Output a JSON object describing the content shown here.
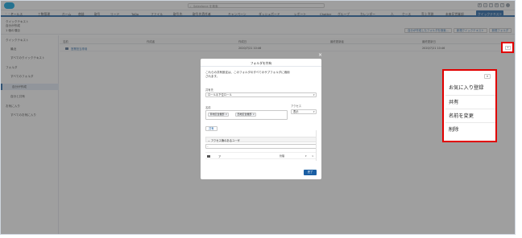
{
  "header": {
    "search_placeholder": "Salesforce を検索",
    "search_scope": "すべて"
  },
  "nav": {
    "items": [
      "セールス",
      "工数管理",
      "ホーム",
      "商談",
      "取引",
      "リード",
      "ToDo",
      "ファイル",
      "取引先",
      "取引先責任者",
      "キャンペーン",
      "ダッシュボード",
      "レポート",
      "Chatter",
      "グループ",
      "カレンダー",
      "人",
      "ケース",
      "売上予測",
      "未来区営業部",
      "クイックテキスト"
    ]
  },
  "titlebar": {
    "line1": "クイックテキスト",
    "line2": "自分が作成",
    "line3": "1 個の項目",
    "buttons": [
      "自分が作成したフォルダを検索...",
      "新規クイックテキスト",
      "新規フォルダ"
    ]
  },
  "sidebar": {
    "items": [
      {
        "label": "クイックテキスト",
        "child": false
      },
      {
        "label": "最近",
        "child": true
      },
      {
        "label": "すべてのクイックテキスト",
        "child": true
      },
      {
        "label": "フォルダ",
        "child": false
      },
      {
        "label": "すべてのフォルダ",
        "child": true
      },
      {
        "label": "自分が作成",
        "child": true,
        "selected": true
      },
      {
        "label": "自分と共有",
        "child": true
      },
      {
        "label": "お気に入り",
        "child": false
      },
      {
        "label": "すべてのお気に入り",
        "child": true
      }
    ]
  },
  "table": {
    "columns": [
      "名前",
      "作成者",
      "作成日",
      "最終更新者",
      "最終更新日"
    ],
    "rows": [
      {
        "name": "営業担当専用",
        "created_by": "",
        "created_date": "2020/7/21 10:46",
        "modified_by": "",
        "modified_date": "2020/7/21 10:46"
      }
    ]
  },
  "modal": {
    "title": "フォルダを共有",
    "description_line1": "これらの共有設定は、このフォルダのすべてのサブフォルダに適用",
    "description_line2": "されます。",
    "share_with_label": "共有先",
    "share_with_value": "ロール＆下位ロール",
    "name_label": "名前",
    "access_label": "アクセス",
    "access_value": "表示",
    "pills": [
      "東地区営業部",
      "西地区営業部"
    ],
    "share_button": "共有",
    "section_title": "アクセス権のあるユーザ",
    "user_row": {
      "name": "ア",
      "access": "管理"
    },
    "done_button": "完了"
  },
  "dropdown": {
    "items": [
      "お気に入り登録",
      "共有",
      "名前を変更",
      "削除"
    ]
  },
  "colors": {
    "brand": "#1b5fa4",
    "highlight": "#e10000",
    "logo": "#00a1e0"
  }
}
